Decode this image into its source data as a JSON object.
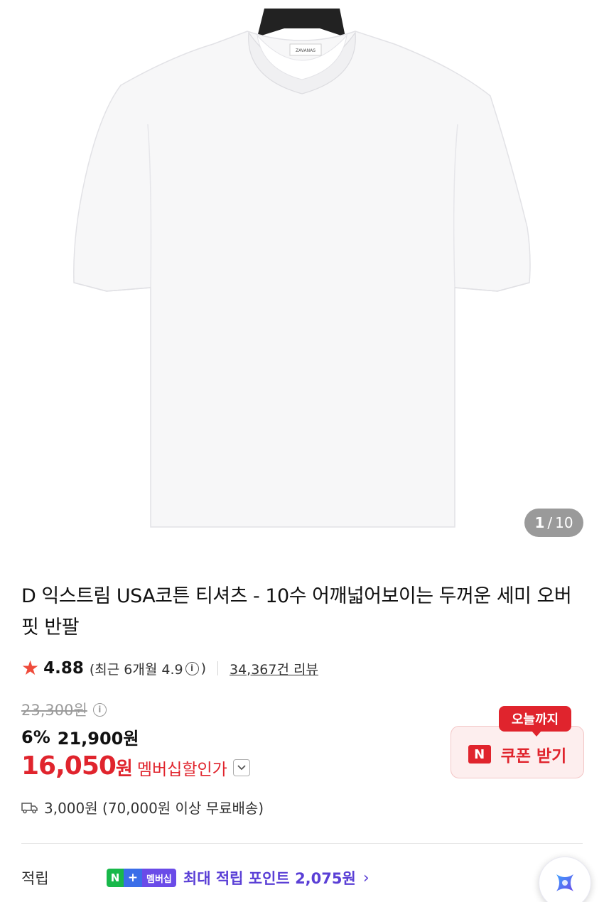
{
  "hero": {
    "alt": "white t-shirt on hanger",
    "brand_tag": "ZAVANAS",
    "counter_current": "1",
    "counter_total": "10"
  },
  "product": {
    "title": "D 익스트림 USA코튼 티셔츠 - 10수 어깨넓어보이는 두꺼운 세미 오버핏 반팔"
  },
  "rating": {
    "score": "4.88",
    "recent_prefix": "(최근 6개월 4.9",
    "recent_suffix": ")",
    "reviews": "34,367건 리뷰"
  },
  "price": {
    "original": "23,300원",
    "discount_pct": "6%",
    "discount_price": "21,900원",
    "member_price": "16,050",
    "member_won": "원",
    "member_label": "멤버십할인가"
  },
  "shipping": {
    "text": "3,000원 (70,000원 이상 무료배송)"
  },
  "coupon": {
    "tag": "오늘까지",
    "logo": "N",
    "label": "쿠폰 받기"
  },
  "points": {
    "label": "적립",
    "badge_n": "N",
    "badge_plus": "+",
    "badge_membership": "멤버십",
    "text": "최대 적립 포인트 2,075원",
    "chevron": "›"
  },
  "colors": {
    "accent_red": "#e0242d",
    "points_purple": "#5a3fd6",
    "naver_green": "#18b84a"
  }
}
